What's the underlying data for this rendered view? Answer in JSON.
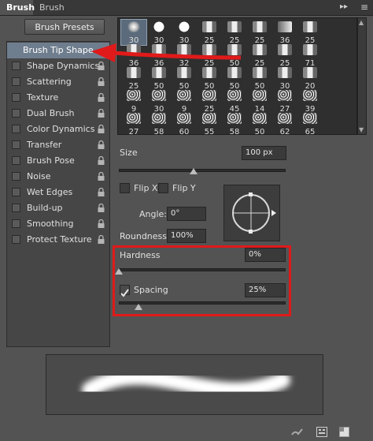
{
  "tabs": [
    {
      "label": "Brush"
    },
    {
      "label": "Brush Presets"
    }
  ],
  "tab_icons": {
    "menu": "double-chevron-right-icon",
    "options": "panel-menu-icon"
  },
  "presets_button": "Brush Presets",
  "left_list": [
    {
      "label": "Brush Tip Shape",
      "selected": true,
      "lock": false
    },
    {
      "label": "Shape Dynamics",
      "checked": false,
      "lock": true
    },
    {
      "label": "Scattering",
      "checked": false,
      "lock": true
    },
    {
      "label": "Texture",
      "checked": false,
      "lock": true
    },
    {
      "label": "Dual Brush",
      "checked": false,
      "lock": true
    },
    {
      "label": "Color Dynamics",
      "checked": false,
      "lock": true
    },
    {
      "label": "Transfer",
      "checked": false,
      "lock": true
    },
    {
      "label": "Brush Pose",
      "checked": false,
      "lock": true
    },
    {
      "label": "Noise",
      "checked": false,
      "lock": true
    },
    {
      "label": "Wet Edges",
      "checked": false,
      "lock": true
    },
    {
      "label": "Build-up",
      "checked": false,
      "lock": true
    },
    {
      "label": "Smoothing",
      "checked": false,
      "lock": true
    },
    {
      "label": "Protect Texture",
      "checked": false,
      "lock": true
    }
  ],
  "brush_sizes": [
    "30",
    "30",
    "30",
    "25",
    "25",
    "25",
    "36",
    "25",
    "36",
    "36",
    "32",
    "25",
    "50",
    "25",
    "25",
    "71",
    "25",
    "50",
    "50",
    "50",
    "50",
    "50",
    "30",
    "20",
    "9",
    "30",
    "9",
    "25",
    "45",
    "14",
    "27",
    "39",
    "27",
    "58",
    "60",
    "55",
    "58",
    "50",
    "62",
    "65"
  ],
  "size": {
    "label": "Size",
    "value": "100 px",
    "level": 0.45
  },
  "flip_x": {
    "label": "Flip X",
    "checked": false
  },
  "flip_y": {
    "label": "Flip Y",
    "checked": false
  },
  "angle": {
    "label": "Angle:",
    "value": "0°"
  },
  "roundness": {
    "label": "Roundness:",
    "value": "100%"
  },
  "hardness": {
    "label": "Hardness",
    "value": "0%",
    "level": 0.0
  },
  "spacing": {
    "label": "Spacing",
    "value": "25%",
    "checked": true,
    "level": 0.12
  },
  "colors": {
    "highlight": "#e01a1a",
    "selected_row": "#6f7e8e"
  },
  "bottom_icons": [
    "brush-check-icon",
    "panel-grid-icon",
    "new-preset-icon"
  ]
}
